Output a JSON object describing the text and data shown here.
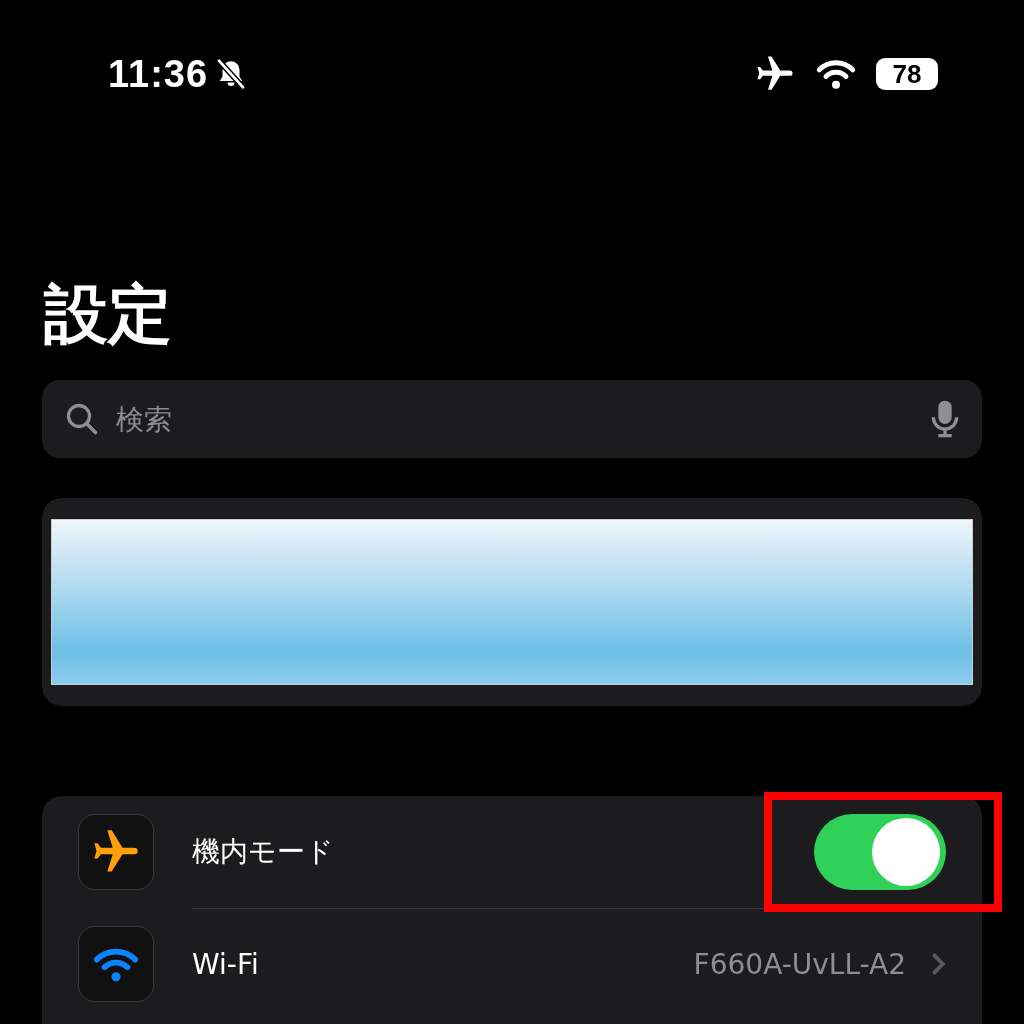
{
  "status_bar": {
    "time": "11:36",
    "battery": "78"
  },
  "title": "設定",
  "search": {
    "placeholder": "検索"
  },
  "settings": [
    {
      "kind": "toggle",
      "label": "機内モード",
      "on": true,
      "color": "#ff9f0a",
      "highlighted": true
    },
    {
      "kind": "link",
      "label": "Wi-Fi",
      "value": "F660A-UvLL-A2",
      "color": "#0a84ff",
      "highlighted": false
    }
  ]
}
